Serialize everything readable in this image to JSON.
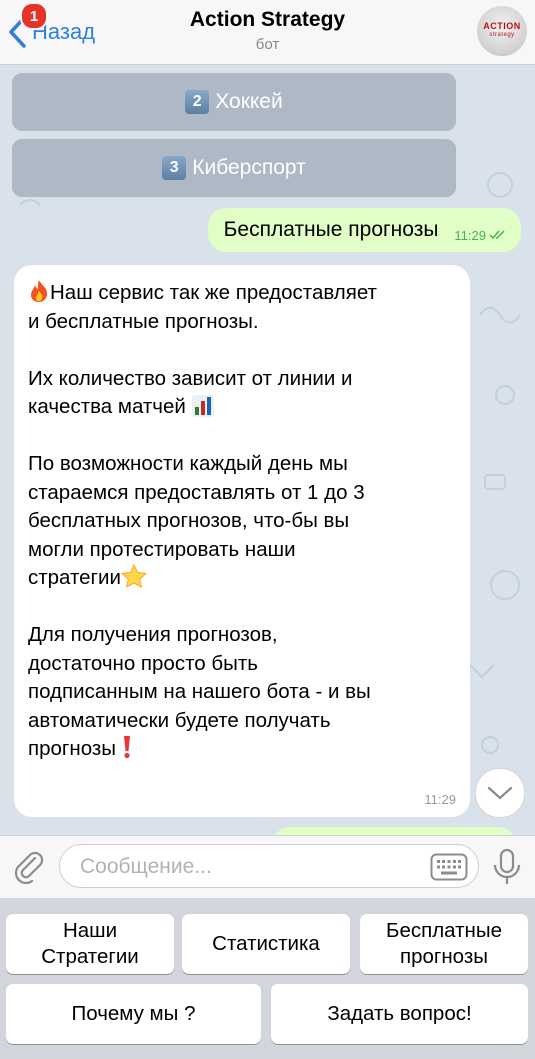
{
  "header": {
    "back_label": "Назад",
    "unread_count": "1",
    "title": "Action Strategy",
    "subtitle": "бот",
    "avatar_text": "ACTION",
    "avatar_subtext": "strategy"
  },
  "chat": {
    "inline_buttons": [
      {
        "num": "2",
        "label": "Хоккей"
      },
      {
        "num": "3",
        "label": "Киберспорт"
      }
    ],
    "outgoing": {
      "text": "Бесплатные прогнозы",
      "time": "11:29"
    },
    "incoming": {
      "paragraphs": [
        "Наш сервис так же предоставляет\nи бесплатные прогнозы.",
        "Их количество зависит от линии и\nкачества матчей",
        "По возможности каждый день мы\nстараемся предоставлять от 1 до 3\nбесплатных прогнозов, что-бы вы\nмогли протестировать наши\nстратегии",
        "Для получения прогнозов,\nдостаточно просто быть\nподписанным на нашего бота - и вы\nавтоматически будете получать\nпрогнозы"
      ],
      "time": "11:29"
    }
  },
  "input": {
    "placeholder": "Сообщение..."
  },
  "keyboard": {
    "row1": [
      "Наши\nСтратегии",
      "Статистика",
      "Бесплатные\nпрогнозы"
    ],
    "row2": [
      "Почему мы ?",
      "Задать вопрос!"
    ]
  },
  "colors": {
    "accent": "#2f7fe0",
    "outgoing_bubble": "#e1fec6",
    "badge": "#e5332a"
  },
  "icons": [
    "chevron-left-icon",
    "paperclip-icon",
    "keyboard-icon",
    "microphone-icon",
    "chevron-down-icon",
    "double-check-icon",
    "fire-icon",
    "bar-chart-icon",
    "star-icon",
    "exclamation-icon"
  ]
}
